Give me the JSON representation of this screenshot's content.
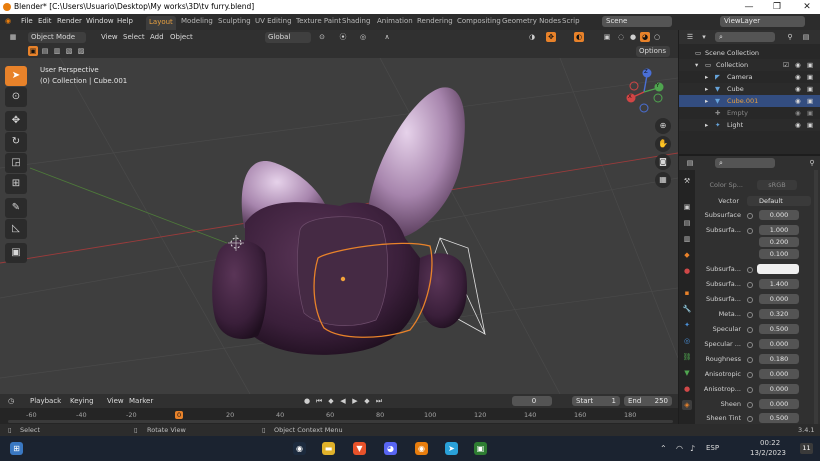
{
  "title_bar": {
    "title": "Blender* [C:\\Users\\Usuario\\Desktop\\My works\\3D\\tv furry.blend]",
    "minimize": "—",
    "maximize": "❐",
    "close": "✕"
  },
  "menu": [
    "File",
    "Edit",
    "Render",
    "Window",
    "Help"
  ],
  "workspaces": [
    "Layout",
    "Modeling",
    "Sculpting",
    "UV Editing",
    "Texture Paint",
    "Shading",
    "Animation",
    "Rendering",
    "Compositing",
    "Geometry Nodes",
    "Scrip"
  ],
  "scene_field": "Scene",
  "viewlayer_field": "ViewLayer",
  "viewport_header": {
    "mode": "Object Mode",
    "view": "View",
    "select": "Select",
    "add": "Add",
    "object": "Object",
    "orientation": "Global",
    "options": "Options"
  },
  "viewport_overlay": {
    "perspective": "User Perspective",
    "collection": "(0) Collection | Cube.001"
  },
  "gizmo": {
    "z": "Z",
    "y": "Y",
    "x": "X"
  },
  "timeline": {
    "playback": "Playback",
    "keying": "Keying",
    "view": "View",
    "marker": "Marker",
    "current_frame": "0",
    "start_label": "Start",
    "start": "1",
    "end_label": "End",
    "end": "250"
  },
  "ruler_ticks": [
    "-60",
    "-40",
    "-20",
    "0",
    "20",
    "40",
    "60",
    "80",
    "100",
    "120",
    "140",
    "160",
    "180"
  ],
  "status": {
    "select": "Select",
    "rotate": "Rotate View",
    "context": "Object Context Menu",
    "version": "3.4.1"
  },
  "outliner": {
    "header": "Scene Collection",
    "rows": [
      {
        "name": "Collection",
        "indent": 1,
        "selected": false
      },
      {
        "name": "Camera",
        "indent": 2,
        "selected": false
      },
      {
        "name": "Cube",
        "indent": 2,
        "selected": false
      },
      {
        "name": "Cube.001",
        "indent": 2,
        "selected": true
      },
      {
        "name": "Empty",
        "indent": 2,
        "selected": false
      },
      {
        "name": "Light",
        "indent": 2,
        "selected": false
      }
    ]
  },
  "properties": {
    "color_space_label": "Color Sp...",
    "color_space": "sRGB",
    "vector_label": "Vector",
    "vector": "Default",
    "rows": [
      {
        "label": "Subsurface",
        "value": "0.000"
      },
      {
        "label": "Subsurfa...",
        "value": "1.000"
      },
      {
        "label": "",
        "value": "0.200"
      },
      {
        "label": "",
        "value": "0.100"
      },
      {
        "label": "Subsurfa...",
        "value": ""
      },
      {
        "label": "Subsurfa...",
        "value": "1.400"
      },
      {
        "label": "Subsurfa...",
        "value": "0.000"
      },
      {
        "label": "Meta...",
        "value": "0.320"
      },
      {
        "label": "Specular",
        "value": "0.500"
      },
      {
        "label": "Specular ...",
        "value": "0.000"
      },
      {
        "label": "Roughness",
        "value": "0.180"
      },
      {
        "label": "Anisotropic",
        "value": "0.000"
      },
      {
        "label": "Anisotrop...",
        "value": "0.000"
      },
      {
        "label": "Sheen",
        "value": "0.000"
      },
      {
        "label": "Sheen Tint",
        "value": "0.500"
      }
    ]
  },
  "taskbar": {
    "time": "00:22",
    "date": "13/2/2023",
    "lang": "ESP",
    "notif": "11"
  },
  "colors": {
    "accent": "#e8822a",
    "selection": "#334d80",
    "object_purple": "#3a1f3a",
    "ears": "#b48fb8"
  }
}
